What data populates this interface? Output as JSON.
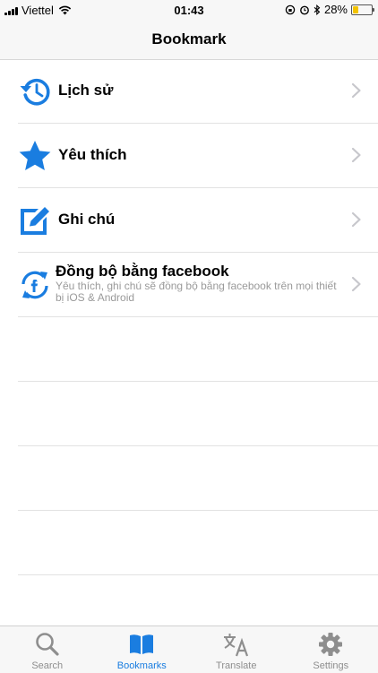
{
  "status_bar": {
    "carrier": "Viettel",
    "time": "01:43",
    "battery_percent": "28%",
    "battery_level": 0.28
  },
  "nav": {
    "title": "Bookmark"
  },
  "list": {
    "items": [
      {
        "label": "Lịch sử",
        "icon": "history-icon"
      },
      {
        "label": "Yêu thích",
        "icon": "star-icon"
      },
      {
        "label": "Ghi chú",
        "icon": "note-edit-icon"
      },
      {
        "label": "Đồng bộ bằng facebook",
        "subtitle": "Yêu thích, ghi chú sẽ đồng bộ bằng facebook trên mọi thiết bị iOS & Android",
        "icon": "facebook-sync-icon"
      }
    ]
  },
  "tabs": [
    {
      "label": "Search",
      "icon": "search-icon",
      "active": false
    },
    {
      "label": "Bookmarks",
      "icon": "book-icon",
      "active": true
    },
    {
      "label": "Translate",
      "icon": "translate-icon",
      "active": false
    },
    {
      "label": "Settings",
      "icon": "gear-icon",
      "active": false
    }
  ],
  "colors": {
    "accent": "#1a7de0",
    "inactive": "#8e8e8e",
    "battery": "#f2c300"
  }
}
